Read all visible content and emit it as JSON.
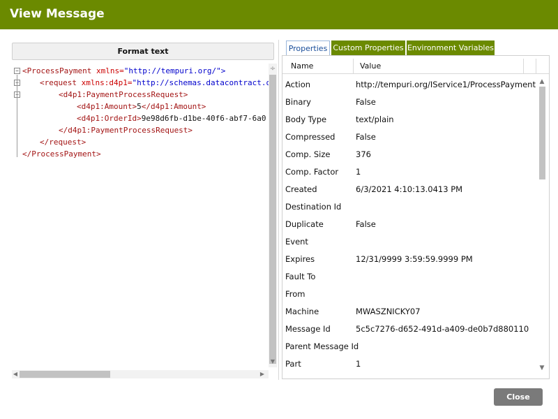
{
  "window": {
    "title": "View Message",
    "titlebar_color": "#6b8a00"
  },
  "left_pane": {
    "format_button_label": "Format text",
    "xml_lines": [
      {
        "tag_open": "<ProcessPayment ",
        "attr": "xmlns=",
        "value": "\"http://tempuri.org/\"",
        "close": ">"
      },
      {
        "tag_open": "<request ",
        "attr": "xmlns:d4p1=",
        "value": "\"http://schemas.datacontract.o",
        "close": ""
      },
      {
        "tag_open": "<d4p1:PaymentProcessRequest>",
        "attr": "",
        "value": "",
        "close": ""
      },
      {
        "tag_open": "<d4p1:Amount>",
        "text": "5",
        "tag_close": "</d4p1:Amount>"
      },
      {
        "tag_open": "<d4p1:OrderId>",
        "text": "9e98d6fb-d1be-40f6-abf7-6a0",
        "tag_close": ""
      },
      {
        "tag_open": "</d4p1:PaymentProcessRequest>"
      },
      {
        "tag_open": "</request>"
      },
      {
        "tag_open": "</ProcessPayment>"
      }
    ],
    "fold_glyph": "−",
    "splitter_glyph": "÷",
    "arrow_left": "◀",
    "arrow_right": "▶",
    "arrow_down": "▼"
  },
  "right_pane": {
    "tabs": [
      {
        "label": "Properties",
        "active": true
      },
      {
        "label": "Custom Properties",
        "active": false
      },
      {
        "label": "Environment Variables",
        "active": false
      }
    ],
    "columns": [
      "Name",
      "Value"
    ],
    "rows": [
      {
        "name": "Action",
        "value": "http://tempuri.org/IService1/ProcessPayment"
      },
      {
        "name": "Binary",
        "value": "False"
      },
      {
        "name": "Body Type",
        "value": "text/plain"
      },
      {
        "name": "Compressed",
        "value": "False"
      },
      {
        "name": "Comp. Size",
        "value": "376"
      },
      {
        "name": "Comp. Factor",
        "value": "1"
      },
      {
        "name": "Created",
        "value": "6/3/2021 4:10:13.0413 PM"
      },
      {
        "name": "Destination Id",
        "value": ""
      },
      {
        "name": "Duplicate",
        "value": "False"
      },
      {
        "name": "Event",
        "value": ""
      },
      {
        "name": "Expires",
        "value": "12/31/9999 3:59:59.9999 PM"
      },
      {
        "name": "Fault To",
        "value": ""
      },
      {
        "name": "From",
        "value": ""
      },
      {
        "name": "Machine",
        "value": "MWASZNICKY07"
      },
      {
        "name": "Message Id",
        "value": "5c5c7276-d652-491d-a409-de0b7d880110"
      },
      {
        "name": "Parent Message Id",
        "value": ""
      },
      {
        "name": "Part",
        "value": "1"
      }
    ],
    "scroll_up": "▲",
    "scroll_down": "▼"
  },
  "footer": {
    "close_label": "Close"
  }
}
